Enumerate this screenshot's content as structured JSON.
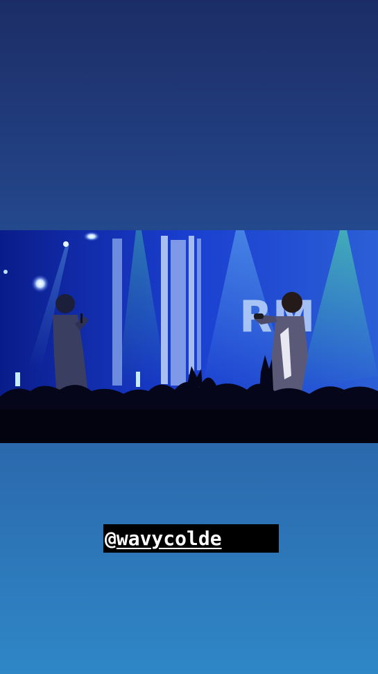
{
  "story": {
    "background_top_color": "#1c2d66",
    "background_bottom_color": "#2f87c6"
  },
  "media": {
    "kind": "concert video frame",
    "stage_screen_text": "RM",
    "colors": {
      "stage_blue": "#1037c8",
      "spotlight_green": "#3fd98a",
      "crowd": "#050510"
    }
  },
  "mention": {
    "prefix": "@",
    "handle": "wavycolde"
  }
}
